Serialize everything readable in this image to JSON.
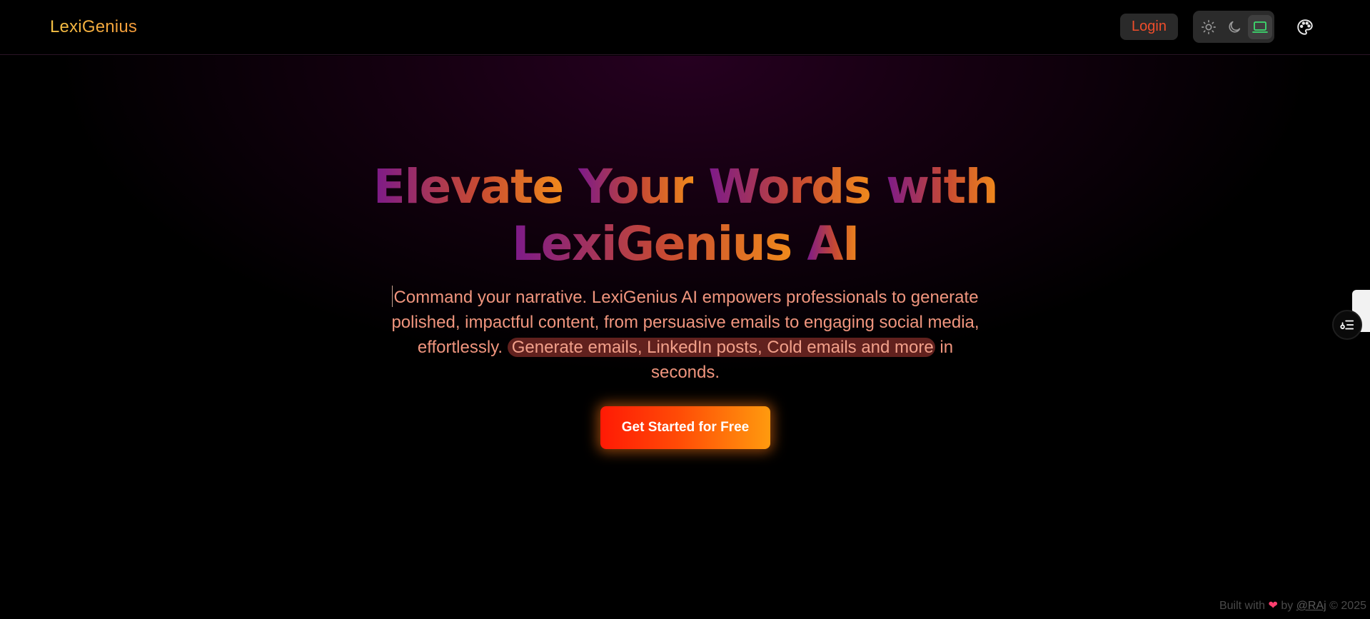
{
  "header": {
    "logo": "LexiGenius",
    "login_label": "Login",
    "theme_options": [
      {
        "name": "light",
        "icon": "sun-icon"
      },
      {
        "name": "dark",
        "icon": "moon-icon"
      },
      {
        "name": "system",
        "icon": "laptop-icon",
        "active": true
      }
    ],
    "palette_icon": "palette-icon"
  },
  "hero": {
    "title_line1_words": [
      "Elevate",
      "Your",
      "Words",
      "with"
    ],
    "title_line2_words": [
      "LexiGenius",
      "AI"
    ],
    "description_lead": "Command your narrative. LexiGenius AI empowers professionals to generate polished, impactful content, from persuasive emails to engaging social media, effortlessly.",
    "description_highlight": "Generate emails, LinkedIn posts, Cold emails and more",
    "description_tail": " in seconds.",
    "cta_label": "Get Started for Free"
  },
  "footer": {
    "prefix": "Built with",
    "heart": "❤",
    "by": "by",
    "author": "@RAj",
    "copyright": "© 2025"
  },
  "colors": {
    "accent_gradient_start": "#7c1a8a",
    "accent_gradient_mid": "#c74a32",
    "accent_gradient_end": "#f08a1c",
    "description_text": "#f0957e",
    "cta_start": "#ff1a05",
    "cta_end": "#ff9a0e",
    "login_text": "#ef4d2b",
    "active_theme_icon": "#3ddc6e"
  }
}
